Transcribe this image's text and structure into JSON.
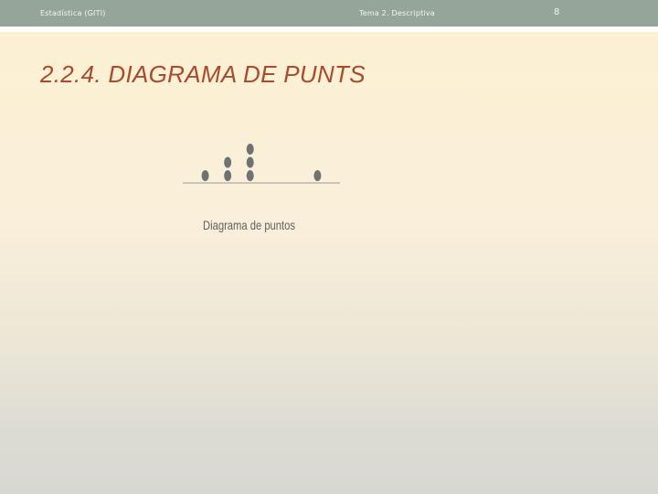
{
  "header": {
    "left": "Estadística (GITI)",
    "center": "Tema 2. Descriptiva",
    "page_number": "8"
  },
  "title": "2.2.4. DIAGRAMA DE PUNTS",
  "chart_data": {
    "type": "scatter",
    "title": "",
    "caption": "Diagrama de puntos",
    "xlabel": "",
    "ylabel": "",
    "xlim": [
      0,
      7
    ],
    "counts": [
      {
        "x": 1,
        "count": 1
      },
      {
        "x": 2,
        "count": 2
      },
      {
        "x": 3,
        "count": 3
      },
      {
        "x": 6,
        "count": 1
      }
    ],
    "grid": false,
    "colors": {
      "dot": "#6f7273",
      "axis": "#9a9a9a"
    }
  }
}
